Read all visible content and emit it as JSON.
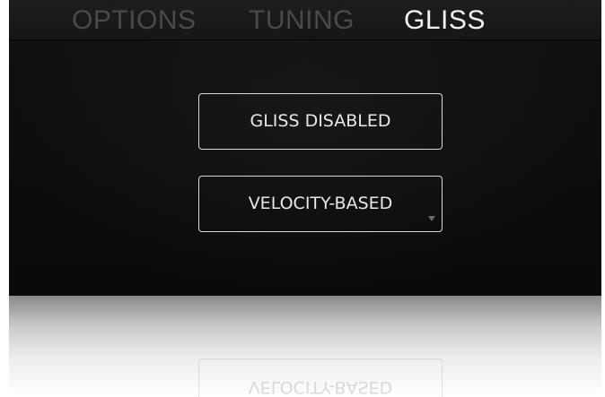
{
  "tabs": [
    {
      "label": "OPTIONS",
      "active": false
    },
    {
      "label": "TUNING",
      "active": false
    },
    {
      "label": "GLISS",
      "active": true
    }
  ],
  "gliss": {
    "mode_button_label": "GLISS DISABLED",
    "type_select_value": "VELOCITY-BASED"
  },
  "colors": {
    "panel_background": "#0c0c0c",
    "tab_inactive": "#4a4a4a",
    "tab_active": "#f2f2f2",
    "button_border": "#d9d9d9"
  }
}
